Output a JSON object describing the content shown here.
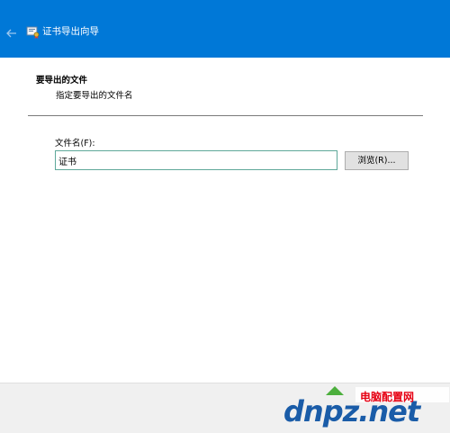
{
  "window": {
    "title": "证书导出向导",
    "back_icon": "back-arrow-icon",
    "wizard_icon": "certificate-wizard-icon",
    "accent_color": "#0078d7"
  },
  "header": {
    "title": "要导出的文件",
    "subtitle": "指定要导出的文件名"
  },
  "form": {
    "filename_label": "文件名(F):",
    "filename_value": "证书",
    "browse_label": "浏览(R)..."
  },
  "watermark": {
    "domain": "dnpz.net",
    "site_name": "电脑配置网"
  }
}
